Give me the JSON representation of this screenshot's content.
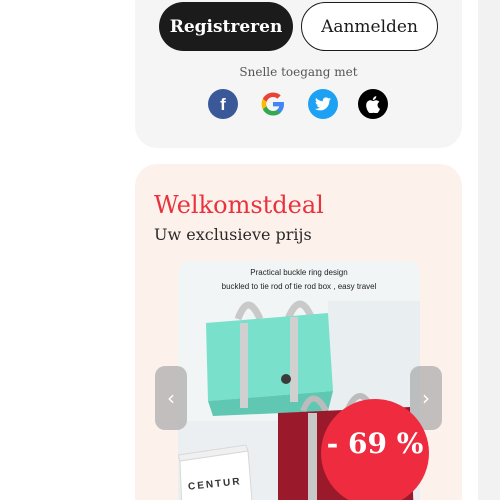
{
  "auth": {
    "register_label": "Registreren",
    "login_label": "Aanmelden",
    "quick_access_label": "Snelle toegang met",
    "socials": [
      {
        "name": "facebook",
        "icon": "facebook-icon",
        "glyph": "f",
        "color": "#3b5998"
      },
      {
        "name": "google",
        "icon": "google-icon",
        "glyph": "G",
        "color": "#4285f4"
      },
      {
        "name": "twitter",
        "icon": "twitter-icon",
        "glyph": "",
        "color": "#1da1f2"
      },
      {
        "name": "apple",
        "icon": "apple-icon",
        "glyph": "",
        "color": "#000000"
      }
    ]
  },
  "deal": {
    "title": "Welkomstdeal",
    "subtitle": "Uw exclusieve prijs",
    "product": {
      "caption_line1": "Practical buckle ring design",
      "caption_line2": "buckled to tie rod of tie rod box , easy travel",
      "box_label": "CENTUR"
    },
    "discount": "- 69 %",
    "prev_arrow": "‹",
    "next_arrow": "›"
  },
  "colors": {
    "accent": "#e8333d",
    "discount_bg": "#ef2b3f",
    "card_bg": "#f5f5f5",
    "deal_bg": "#fdf1ec",
    "dark_button": "#1b1b1b"
  }
}
